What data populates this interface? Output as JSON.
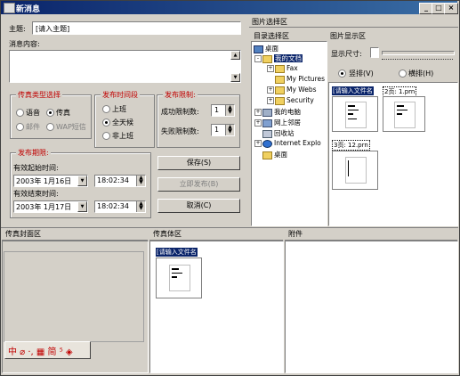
{
  "window": {
    "title": "新消息",
    "min_label": "_",
    "max_label": "□",
    "close_label": "×"
  },
  "subject": {
    "label": "主题:",
    "value": "[请入主题]"
  },
  "message": {
    "label": "消息内容:"
  },
  "fax_type": {
    "title": "传真类型选择",
    "options": [
      "语音",
      "传真",
      "邮件",
      "WAP短信"
    ],
    "selected": "传真"
  },
  "send_time": {
    "title": "发布时间段",
    "options": [
      "上班",
      "全天候",
      "非上班"
    ],
    "selected": "全天候"
  },
  "send_limit": {
    "title": "发布限制:",
    "success_label": "成功限制数:",
    "success_value": "1",
    "fail_label": "失败限制数:",
    "fail_value": "1"
  },
  "validity": {
    "title": "发布期限:",
    "start_label": "有效起始时间:",
    "start_date": "2003年 1月16日",
    "start_time": "18:02:34",
    "end_label": "有效结束时间:",
    "end_date": "2003年 1月17日",
    "end_time": "18:02:34"
  },
  "buttons": {
    "save": "保存(S)",
    "publish": "立即发布(B)",
    "cancel": "取消(C)"
  },
  "picture_select": {
    "title": "图片选择区"
  },
  "directory": {
    "title": "目录选择区",
    "items": [
      "桌面",
      "我的文档",
      "Fax",
      "My Pictures",
      "My Webs",
      "Security",
      "我的电脑",
      "网上邻居",
      "回收站",
      "Internet Explo",
      "桌面"
    ]
  },
  "picture_display": {
    "title": "图片显示区",
    "size_label": "显示尺寸:",
    "layout_options": [
      "竖排(V)",
      "横排(H)"
    ],
    "layout_selected": "竖排(V)",
    "thumbs": [
      "[请输入文件名",
      "2页: 1.prn",
      "3页: 12.prn"
    ]
  },
  "fax_cover": {
    "title": "传真封面区"
  },
  "fax_body": {
    "title": "传真体区",
    "thumbs": [
      "[请输入文件名"
    ]
  },
  "attachment": {
    "title": "附件"
  },
  "ime_toolbar": {
    "text": "中 ⌀ ·, ▦ 简 ⁵ ◈"
  }
}
